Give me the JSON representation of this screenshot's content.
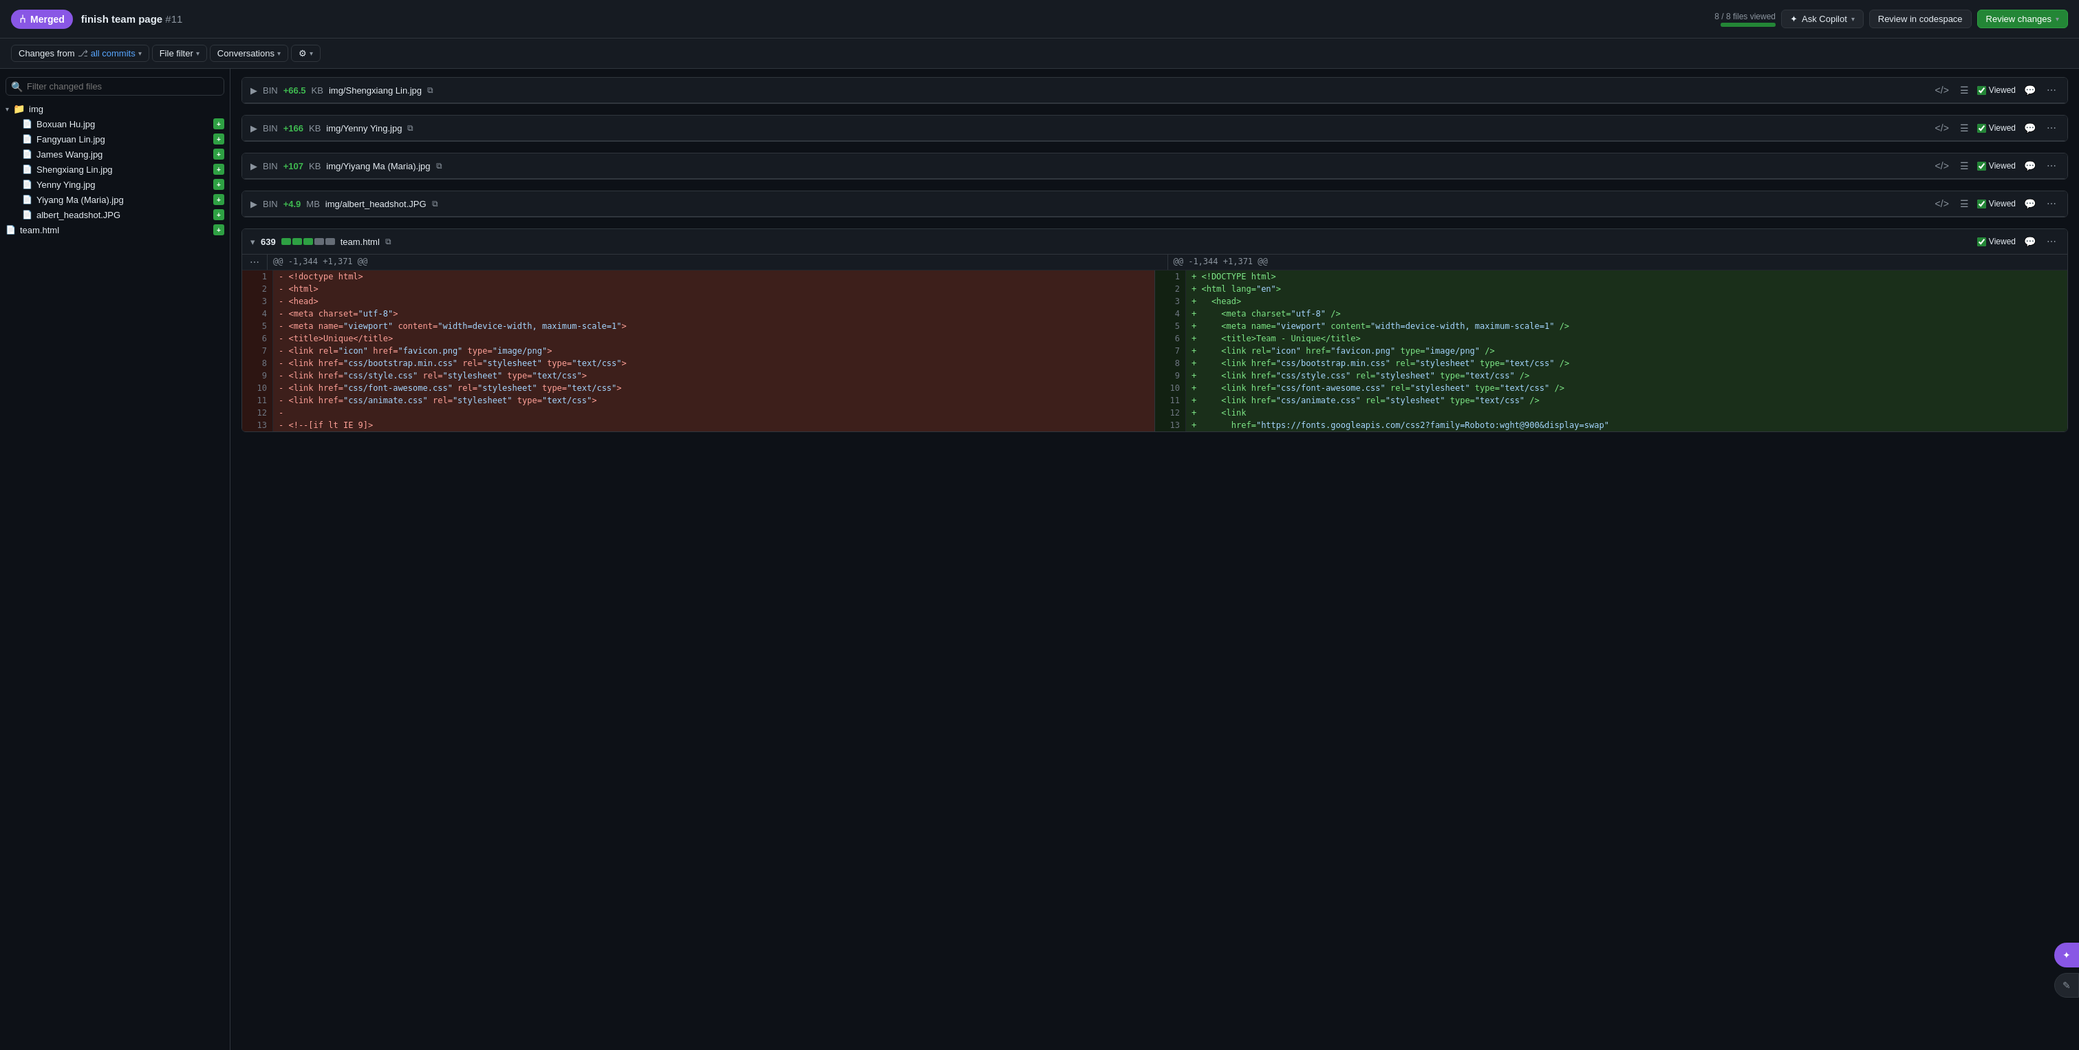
{
  "header": {
    "merged_label": "Merged",
    "pr_title": "finish team page",
    "pr_number": "#11",
    "files_viewed": "8 / 8 files viewed",
    "progress_pct": 100,
    "copilot_label": "Ask Copilot",
    "review_codespace_label": "Review in codespace",
    "review_changes_label": "Review changes"
  },
  "toolbar": {
    "changes_from_label": "Changes from",
    "all_commits_label": "all commits",
    "file_filter_label": "File filter",
    "conversations_label": "Conversations",
    "settings_label": "Settings"
  },
  "sidebar": {
    "search_placeholder": "Filter changed files",
    "folder": {
      "name": "img",
      "files": [
        {
          "name": "Boxuan Hu.jpg",
          "badge": "+"
        },
        {
          "name": "Fangyuan Lin.jpg",
          "badge": "+"
        },
        {
          "name": "James Wang.jpg",
          "badge": "+"
        },
        {
          "name": "Shengxiang Lin.jpg",
          "badge": "+"
        },
        {
          "name": "Yenny Ying.jpg",
          "badge": "+"
        },
        {
          "name": "Yiyang Ma (Maria).jpg",
          "badge": "+"
        },
        {
          "name": "albert_headshot.JPG",
          "badge": "+"
        }
      ]
    },
    "root_file": {
      "name": "team.html",
      "badge": "+"
    }
  },
  "files": [
    {
      "id": "shengxiang",
      "stat": "BIN",
      "add": "+66.5",
      "unit": "KB",
      "path": "img/Shengxiang Lin.jpg",
      "viewed": true
    },
    {
      "id": "yenny",
      "stat": "BIN",
      "add": "+166",
      "unit": "KB",
      "path": "img/Yenny Ying.jpg",
      "viewed": true
    },
    {
      "id": "yiyang",
      "stat": "BIN",
      "add": "+107",
      "unit": "KB",
      "path": "img/Yiyang Ma (Maria).jpg",
      "viewed": true
    },
    {
      "id": "albert",
      "stat": "BIN",
      "add": "+4.9",
      "unit": "MB",
      "path": "img/albert_headshot.JPG",
      "viewed": true
    }
  ],
  "team_html": {
    "count": "639",
    "filename": "team.html",
    "viewed": true,
    "hunk_header": "@@ -1,344 +1,371 @@",
    "left_lines": [
      {
        "num": "1",
        "type": "del",
        "code": "- <!doctype html>"
      },
      {
        "num": "2",
        "type": "del",
        "code": "- <html>"
      },
      {
        "num": "3",
        "type": "del",
        "code": "- <head>"
      },
      {
        "num": "4",
        "type": "del",
        "code": "- <meta charset=\"utf-8\">"
      },
      {
        "num": "5",
        "type": "del",
        "code": "- <meta name=\"viewport\" content=\"width=device-width, maximum-scale=1\">"
      },
      {
        "num": "6",
        "type": "del",
        "code": "- <title>Unique</title>"
      },
      {
        "num": "7",
        "type": "del",
        "code": "- <link rel=\"icon\" href=\"favicon.png\" type=\"image/png\">"
      },
      {
        "num": "8",
        "type": "del",
        "code": "- <link href=\"css/bootstrap.min.css\" rel=\"stylesheet\" type=\"text/css\">"
      },
      {
        "num": "9",
        "type": "del",
        "code": "- <link href=\"css/style.css\" rel=\"stylesheet\" type=\"text/css\">"
      },
      {
        "num": "10",
        "type": "del",
        "code": "- <link href=\"css/font-awesome.css\" rel=\"stylesheet\" type=\"text/css\">"
      },
      {
        "num": "11",
        "type": "del",
        "code": "- <link href=\"css/animate.css\" rel=\"stylesheet\" type=\"text/css\">"
      },
      {
        "num": "12",
        "type": "del",
        "code": "- "
      },
      {
        "num": "13",
        "type": "del",
        "code": "- <!--[if lt IE 9]>"
      }
    ],
    "right_lines": [
      {
        "num": "1",
        "type": "add",
        "code": "+ <!DOCTYPE html>"
      },
      {
        "num": "2",
        "type": "add",
        "code": "+ <html lang=\"en\">"
      },
      {
        "num": "3",
        "type": "add",
        "code": "+   <head>"
      },
      {
        "num": "4",
        "type": "add",
        "code": "+     <meta charset=\"utf-8\" />"
      },
      {
        "num": "5",
        "type": "add",
        "code": "+     <meta name=\"viewport\" content=\"width=device-width, maximum-scale=1\" />"
      },
      {
        "num": "6",
        "type": "add",
        "code": "+     <title>Team - Unique</title>"
      },
      {
        "num": "7",
        "type": "add",
        "code": "+     <link rel=\"icon\" href=\"favicon.png\" type=\"image/png\" />"
      },
      {
        "num": "8",
        "type": "add",
        "code": "+     <link href=\"css/bootstrap.min.css\" rel=\"stylesheet\" type=\"text/css\" />"
      },
      {
        "num": "9",
        "type": "add",
        "code": "+     <link href=\"css/style.css\" rel=\"stylesheet\" type=\"text/css\" />"
      },
      {
        "num": "10",
        "type": "add",
        "code": "+     <link href=\"css/font-awesome.css\" rel=\"stylesheet\" type=\"text/css\" />"
      },
      {
        "num": "11",
        "type": "add",
        "code": "+     <link href=\"css/animate.css\" rel=\"stylesheet\" type=\"text/css\" />"
      },
      {
        "num": "12",
        "type": "add",
        "code": "+     <link"
      },
      {
        "num": "13",
        "type": "add",
        "code": "+       href=\"https://fonts.googleapis.com/css2?family=Roboto:wght@900&display=swap\""
      }
    ]
  }
}
